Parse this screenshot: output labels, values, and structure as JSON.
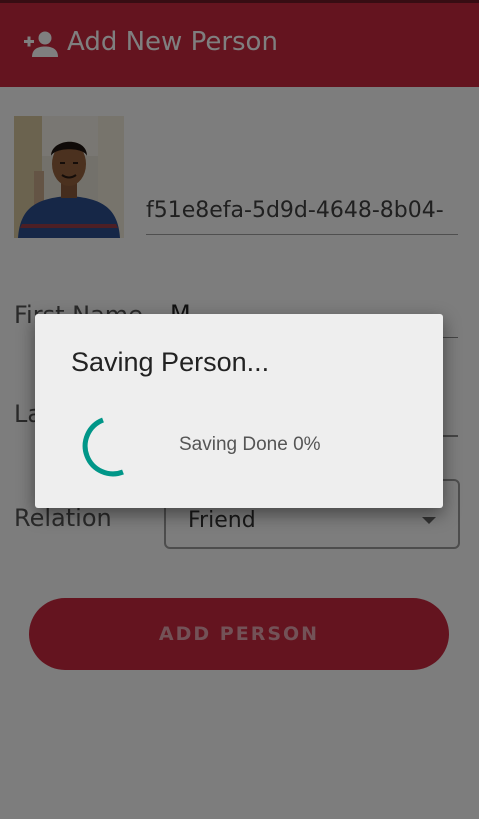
{
  "app": {
    "title": "Add New Person",
    "brand_color": "#c9283f",
    "appbar_icon": "add-person-icon"
  },
  "form": {
    "id_value": "f51e8efa-5d9d-4648-8b04-",
    "first_name_label": "First Name",
    "first_name_value": "M",
    "last_name_label": "Last Name",
    "relation_label": "Relation",
    "relation_value": "Friend",
    "relation_dropdown_icon": "caret-down-icon",
    "submit_label": "ADD PERSON"
  },
  "dialog": {
    "title": "Saving Person...",
    "message": "Saving Done 0%",
    "progress_percent": 0,
    "spinner_color": "#009688",
    "spinner_icon": "progress-spinner-icon"
  }
}
